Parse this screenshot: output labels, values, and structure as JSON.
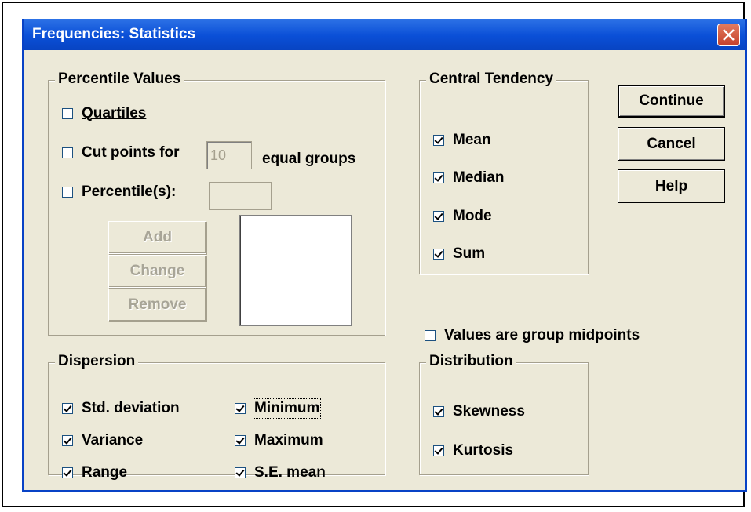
{
  "window": {
    "title": "Frequencies: Statistics"
  },
  "buttons": {
    "continue": "Continue",
    "cancel": "Cancel",
    "help": "Help"
  },
  "percentile_values": {
    "legend": "Percentile Values",
    "quartiles": {
      "label": "Quartiles",
      "checked": false
    },
    "cut_points": {
      "label": "Cut points for",
      "value": "10",
      "suffix": "equal groups",
      "checked": false
    },
    "percentiles": {
      "label": "Percentile(s):",
      "value": "",
      "checked": false
    },
    "add": "Add",
    "change": "Change",
    "remove": "Remove"
  },
  "central_tendency": {
    "legend": "Central Tendency",
    "items": [
      {
        "label": "Mean",
        "checked": true
      },
      {
        "label": "Median",
        "checked": true
      },
      {
        "label": "Mode",
        "checked": true
      },
      {
        "label": "Sum",
        "checked": true
      }
    ]
  },
  "group_midpoints": {
    "label": "Values are group midpoints",
    "checked": false
  },
  "dispersion": {
    "legend": "Dispersion",
    "items": [
      {
        "label": "Std. deviation",
        "checked": true
      },
      {
        "label": "Variance",
        "checked": true
      },
      {
        "label": "Range",
        "checked": true
      },
      {
        "label": "Minimum",
        "checked": true
      },
      {
        "label": "Maximum",
        "checked": true
      },
      {
        "label": "S.E. mean",
        "checked": true
      }
    ]
  },
  "distribution": {
    "legend": "Distribution",
    "items": [
      {
        "label": "Skewness",
        "checked": true
      },
      {
        "label": "Kurtosis",
        "checked": true
      }
    ]
  },
  "colors": {
    "titlebar": "#0a4fd7",
    "dialog_bg": "#ece9d8",
    "close_button": "#c4412b"
  }
}
